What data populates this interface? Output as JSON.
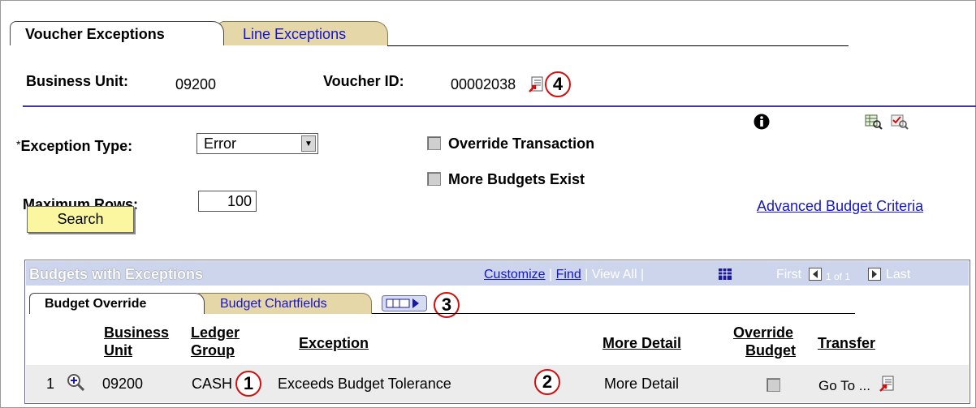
{
  "tabs": {
    "voucher_exceptions": "Voucher Exceptions",
    "line_exceptions": "Line Exceptions"
  },
  "header": {
    "business_unit_label": "Business Unit:",
    "business_unit_value": "09200",
    "voucher_id_label": "Voucher ID:",
    "voucher_id_value": "00002038"
  },
  "form": {
    "exception_type_label": "Exception Type:",
    "exception_type_required_mark": "*",
    "exception_type_value": "Error",
    "maximum_rows_label": "Maximum Rows:",
    "maximum_rows_value": "100",
    "override_transaction_label": "Override Transaction",
    "more_budgets_exist_label": "More Budgets Exist",
    "advanced_budget_criteria_link": "Advanced Budget Criteria",
    "search_button": "Search"
  },
  "grid": {
    "title": "Budgets with Exceptions",
    "customize": "Customize",
    "find": "Find",
    "view_all": "View All",
    "first": "First",
    "page_range": "1 of 1",
    "last": "Last",
    "tabs": [
      "Budget Override",
      "Budget Chartfields"
    ],
    "columns": {
      "business_unit": [
        "Business",
        "Unit"
      ],
      "ledger_group": [
        "Ledger",
        "Group"
      ],
      "exception": "Exception",
      "more_detail": "More Detail",
      "override_budget": [
        "Override",
        "Budget"
      ],
      "transfer": "Transfer"
    },
    "rows": [
      {
        "row_number": "1",
        "business_unit": "09200",
        "ledger_group": "CASH",
        "exception": "Exceeds Budget Tolerance",
        "more_detail": "More Detail",
        "transfer": "Go To ..."
      }
    ]
  },
  "callouts": [
    "1",
    "2",
    "3",
    "4"
  ],
  "colors": {
    "link": "#1515c8",
    "callout_border": "#d01010",
    "search_button_bg": "#fbf6a0",
    "inactive_tab_bg": "#e6d7a8",
    "grid_header_bg": "#cdd5ec"
  }
}
